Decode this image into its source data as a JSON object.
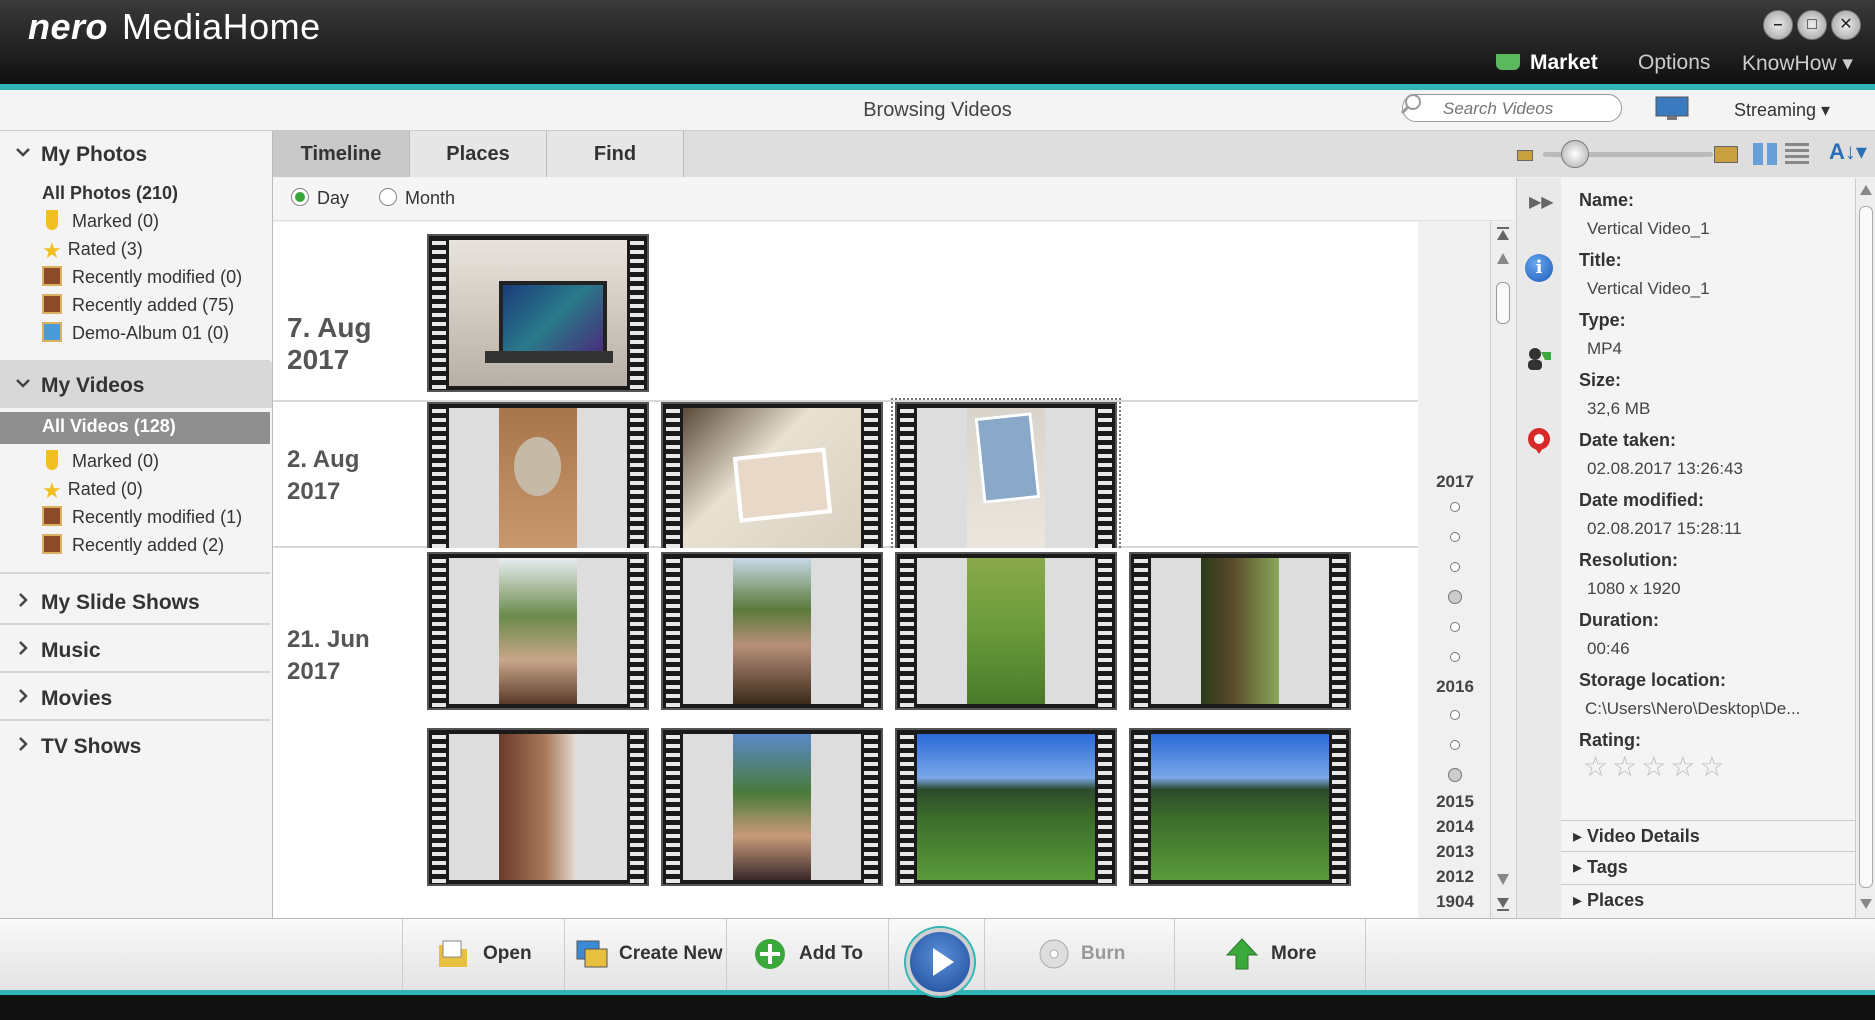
{
  "app": {
    "brand": "nero",
    "name": "MediaHome"
  },
  "window_controls": {
    "minimize": "–",
    "maximize": "□",
    "close": "✕"
  },
  "topmenu": {
    "market": "Market",
    "options": "Options",
    "knowhow": "KnowHow ▾"
  },
  "header": {
    "title": "Browsing Videos",
    "search_placeholder": "Search Videos",
    "streaming": "Streaming ▾"
  },
  "sidebar": {
    "photos": {
      "title": "My Photos",
      "items": [
        "All Photos (210)",
        "Marked (0)",
        "Rated (3)",
        "Recently modified (0)",
        "Recently added (75)",
        "Demo-Album 01 (0)"
      ]
    },
    "videos": {
      "title": "My Videos",
      "items": [
        "All Videos (128)",
        "Marked (0)",
        "Rated (0)",
        "Recently modified (1)",
        "Recently added (2)"
      ]
    },
    "collapsed": [
      "My Slide Shows",
      "Music",
      "Movies",
      "TV Shows"
    ]
  },
  "tabs": [
    "Timeline",
    "Places",
    "Find"
  ],
  "active_tab": "Timeline",
  "radio": {
    "day": "Day",
    "month": "Month",
    "selected": "Day"
  },
  "timeline": [
    {
      "date": "7. Aug\n2017",
      "count": 1
    },
    {
      "date": "2. Aug\n2017",
      "count": 3
    },
    {
      "date": "21. Jun\n2017",
      "count": 8
    }
  ],
  "years": [
    "2017",
    "2016",
    "2015",
    "2014",
    "2013",
    "2012",
    "1904"
  ],
  "details": {
    "name_label": "Name:",
    "name": "Vertical Video_1",
    "title_label": "Title:",
    "title": "Vertical Video_1",
    "type_label": "Type:",
    "type": "MP4",
    "size_label": "Size:",
    "size": "32,6 MB",
    "date_taken_label": "Date taken:",
    "date_taken": "02.08.2017 13:26:43",
    "date_modified_label": "Date modified:",
    "date_modified": "02.08.2017 15:28:11",
    "resolution_label": "Resolution:",
    "resolution": "1080 x 1920",
    "duration_label": "Duration:",
    "duration": "00:46",
    "storage_label": "Storage location:",
    "storage": "C:\\Users\\Nero\\Desktop\\De...",
    "rating_label": "Rating:",
    "rating_stars": "☆☆☆☆☆",
    "sections": [
      "Video Details",
      "Tags",
      "Places"
    ]
  },
  "bottom": {
    "open": "Open",
    "create_new": "Create New",
    "add_to": "Add To",
    "burn": "Burn",
    "more": "More"
  },
  "colors": {
    "accent": "#2fb5b5",
    "selected_bg": "#8f8f8f"
  }
}
